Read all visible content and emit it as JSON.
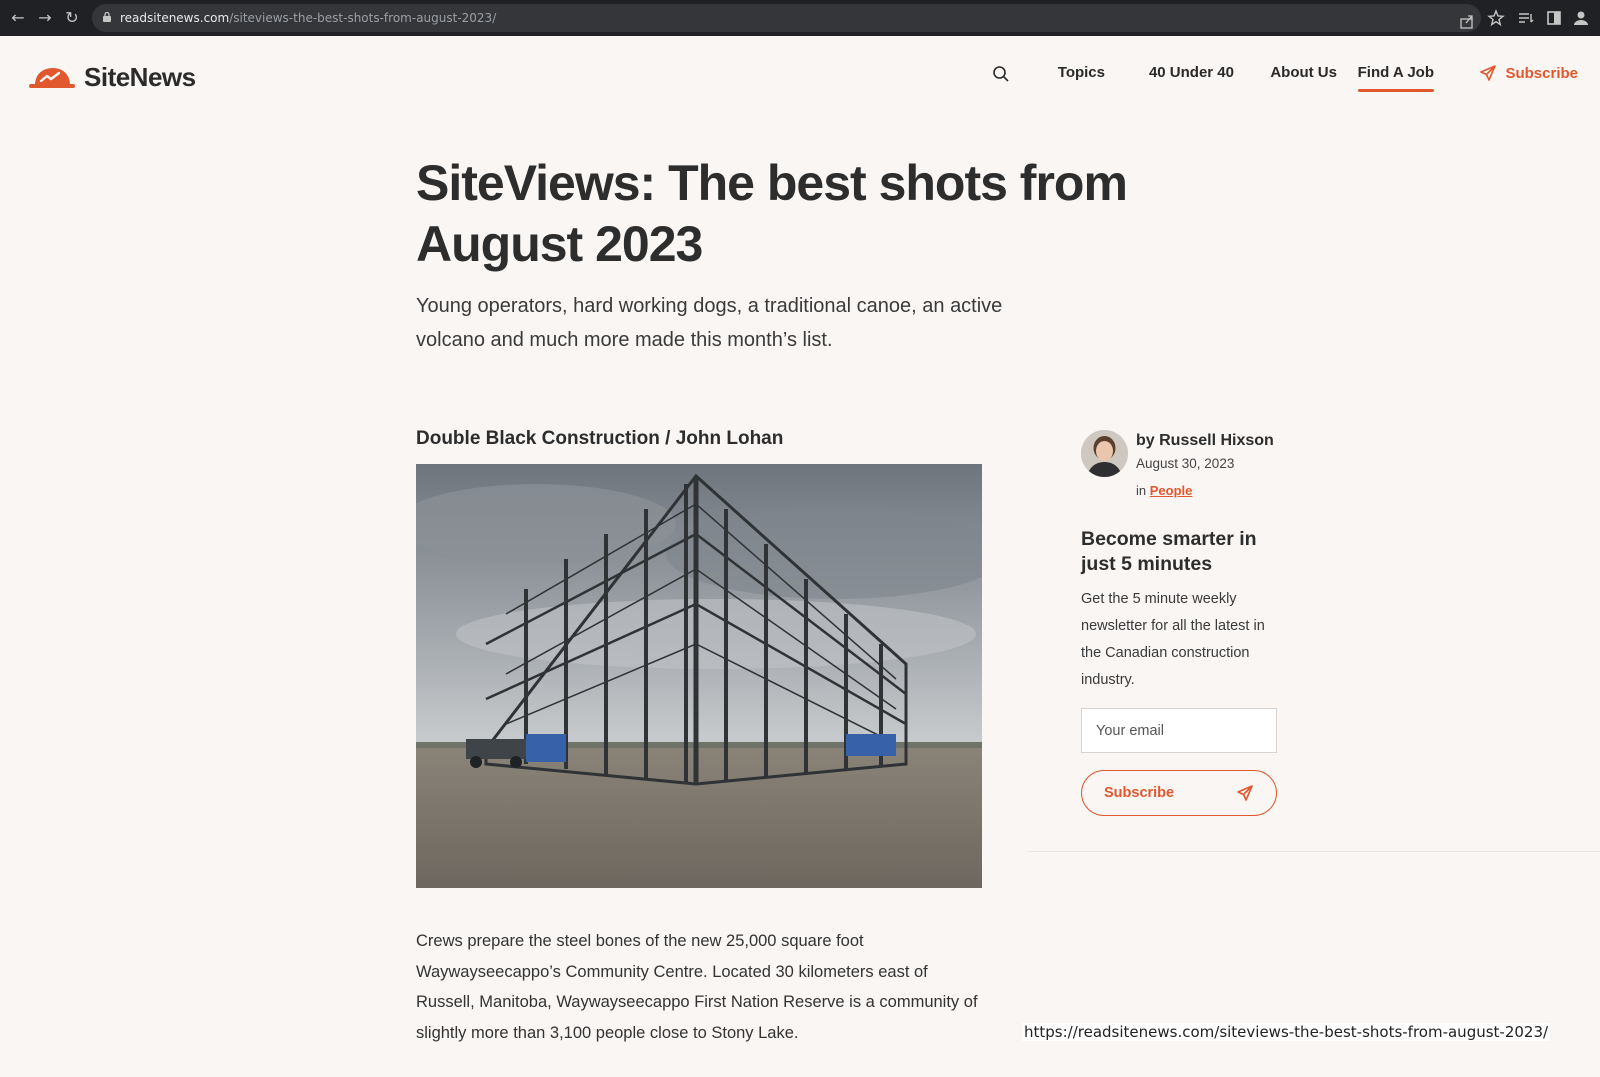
{
  "browser": {
    "url_host": "readsitenews.com",
    "url_path": "/siteviews-the-best-shots-from-august-2023/",
    "icons": [
      "back-arrow-icon",
      "forward-arrow-icon",
      "reload-icon",
      "lock-icon",
      "share-icon",
      "star-icon",
      "reading-list-icon",
      "side-panel-icon",
      "profile-icon"
    ]
  },
  "site": {
    "name": "SiteNews",
    "brand_color": "#e2582e",
    "nav": {
      "topics": "Topics",
      "forty_under_forty": "40 Under 40",
      "about": "About Us",
      "find_job": "Find A Job",
      "subscribe": "Subscribe"
    }
  },
  "article": {
    "title": "SiteViews: The best shots from August 2023",
    "subtitle": "Young operators, hard working dogs, a traditional canoe, an active volcano and much more made this month’s list.",
    "photo_caption": "Double Black Construction / John Lohan",
    "body": "Crews prepare the steel bones of the new 25,000 square foot Waywayseecappo’s Community Centre. Located 30 kilometers east of Russell, Manitoba, Waywayseecappo First Nation Reserve is a community of slightly more than 3,100 people close to Stony Lake."
  },
  "sidebar": {
    "author": "by Russell Hixson",
    "date": "August 30, 2023",
    "category_prefix": "in",
    "category": "People",
    "promo_title": "Become smarter in just 5 minutes",
    "promo_desc": "Get the 5 minute weekly newsletter for all the latest in the Canadian construction industry.",
    "email_placeholder": "Your email",
    "subscribe_label": "Subscribe"
  },
  "status_bar": {
    "url": "https://readsitenews.com/siteviews-the-best-shots-from-august-2023/"
  }
}
